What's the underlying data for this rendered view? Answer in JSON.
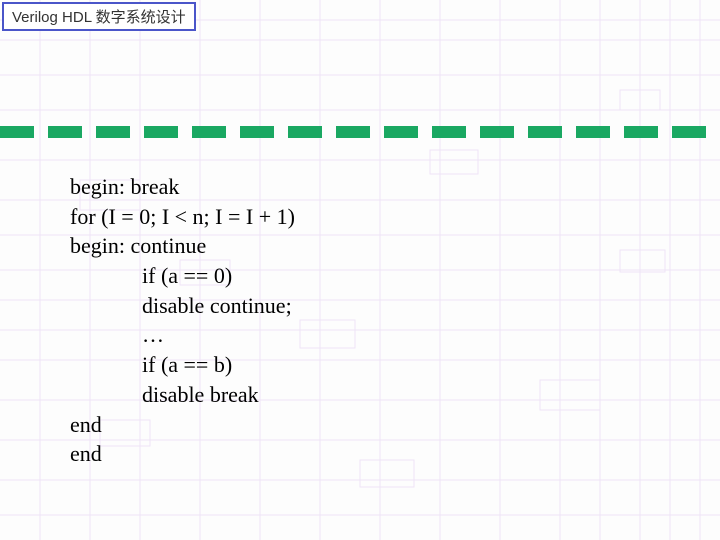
{
  "header": {
    "title": "Verilog HDL 数字系统设计"
  },
  "code": {
    "l1": "begin: break",
    "l2": "for (I = 0; I < n; I = I + 1)",
    "l3": "begin: continue",
    "l4": "if (a == 0)",
    "l5": "disable continue;",
    "l6": "…",
    "l7": "if (a == b)",
    "l8": "disable break",
    "l9": "end",
    "l10": "end"
  }
}
